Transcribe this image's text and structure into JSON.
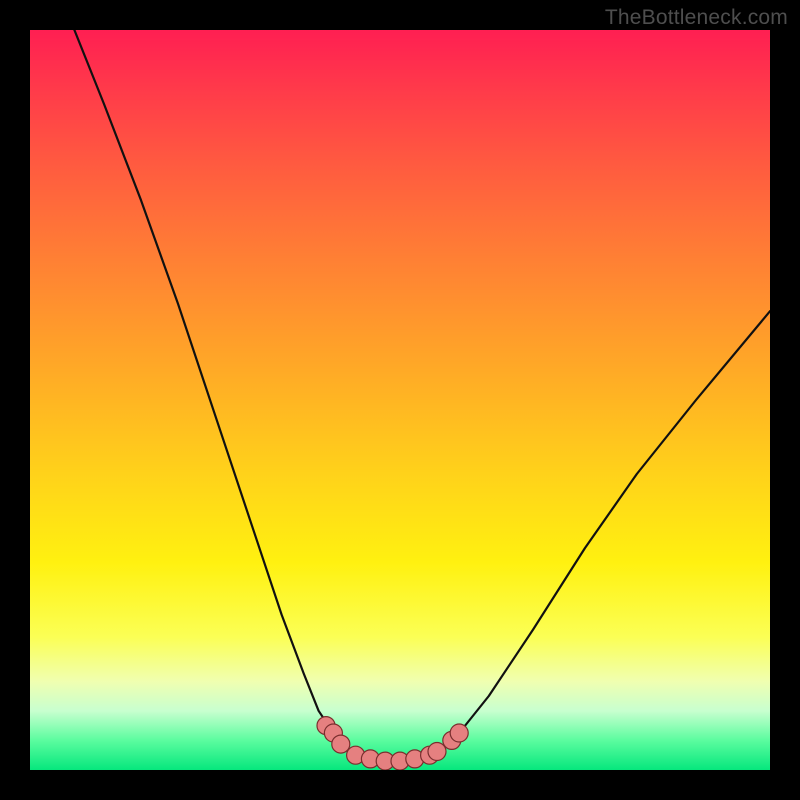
{
  "watermark": "TheBottleneck.com",
  "chart_data": {
    "type": "line",
    "title": "",
    "xlabel": "",
    "ylabel": "",
    "xlim": [
      0,
      100
    ],
    "ylim": [
      0,
      100
    ],
    "grid": false,
    "legend": false,
    "background_gradient": {
      "orientation": "vertical",
      "stops": [
        {
          "pos": 0.0,
          "color": "#ff1f52"
        },
        {
          "pos": 0.18,
          "color": "#ff5a40"
        },
        {
          "pos": 0.45,
          "color": "#ffa727"
        },
        {
          "pos": 0.72,
          "color": "#fff110"
        },
        {
          "pos": 0.88,
          "color": "#f0ffb0"
        },
        {
          "pos": 1.0,
          "color": "#06e77d"
        }
      ]
    },
    "series": [
      {
        "name": "bottleneck-curve",
        "x": [
          6,
          10,
          15,
          20,
          25,
          30,
          34,
          37,
          39,
          41,
          42,
          43,
          44,
          46,
          48,
          50,
          52,
          54,
          56,
          58,
          62,
          68,
          75,
          82,
          90,
          100
        ],
        "y": [
          100,
          90,
          77,
          63,
          48,
          33,
          21,
          13,
          8,
          5,
          3.5,
          2.5,
          2,
          1.5,
          1.2,
          1.2,
          1.5,
          2,
          3,
          5,
          10,
          19,
          30,
          40,
          50,
          62
        ]
      }
    ],
    "markers": {
      "name": "highlight-cluster",
      "color": "#e58080",
      "points": [
        {
          "x": 40,
          "y": 6
        },
        {
          "x": 41,
          "y": 5
        },
        {
          "x": 42,
          "y": 3.5
        },
        {
          "x": 44,
          "y": 2
        },
        {
          "x": 46,
          "y": 1.5
        },
        {
          "x": 48,
          "y": 1.2
        },
        {
          "x": 50,
          "y": 1.2
        },
        {
          "x": 52,
          "y": 1.5
        },
        {
          "x": 54,
          "y": 2
        },
        {
          "x": 55,
          "y": 2.5
        },
        {
          "x": 57,
          "y": 4
        },
        {
          "x": 58,
          "y": 5
        }
      ]
    }
  }
}
